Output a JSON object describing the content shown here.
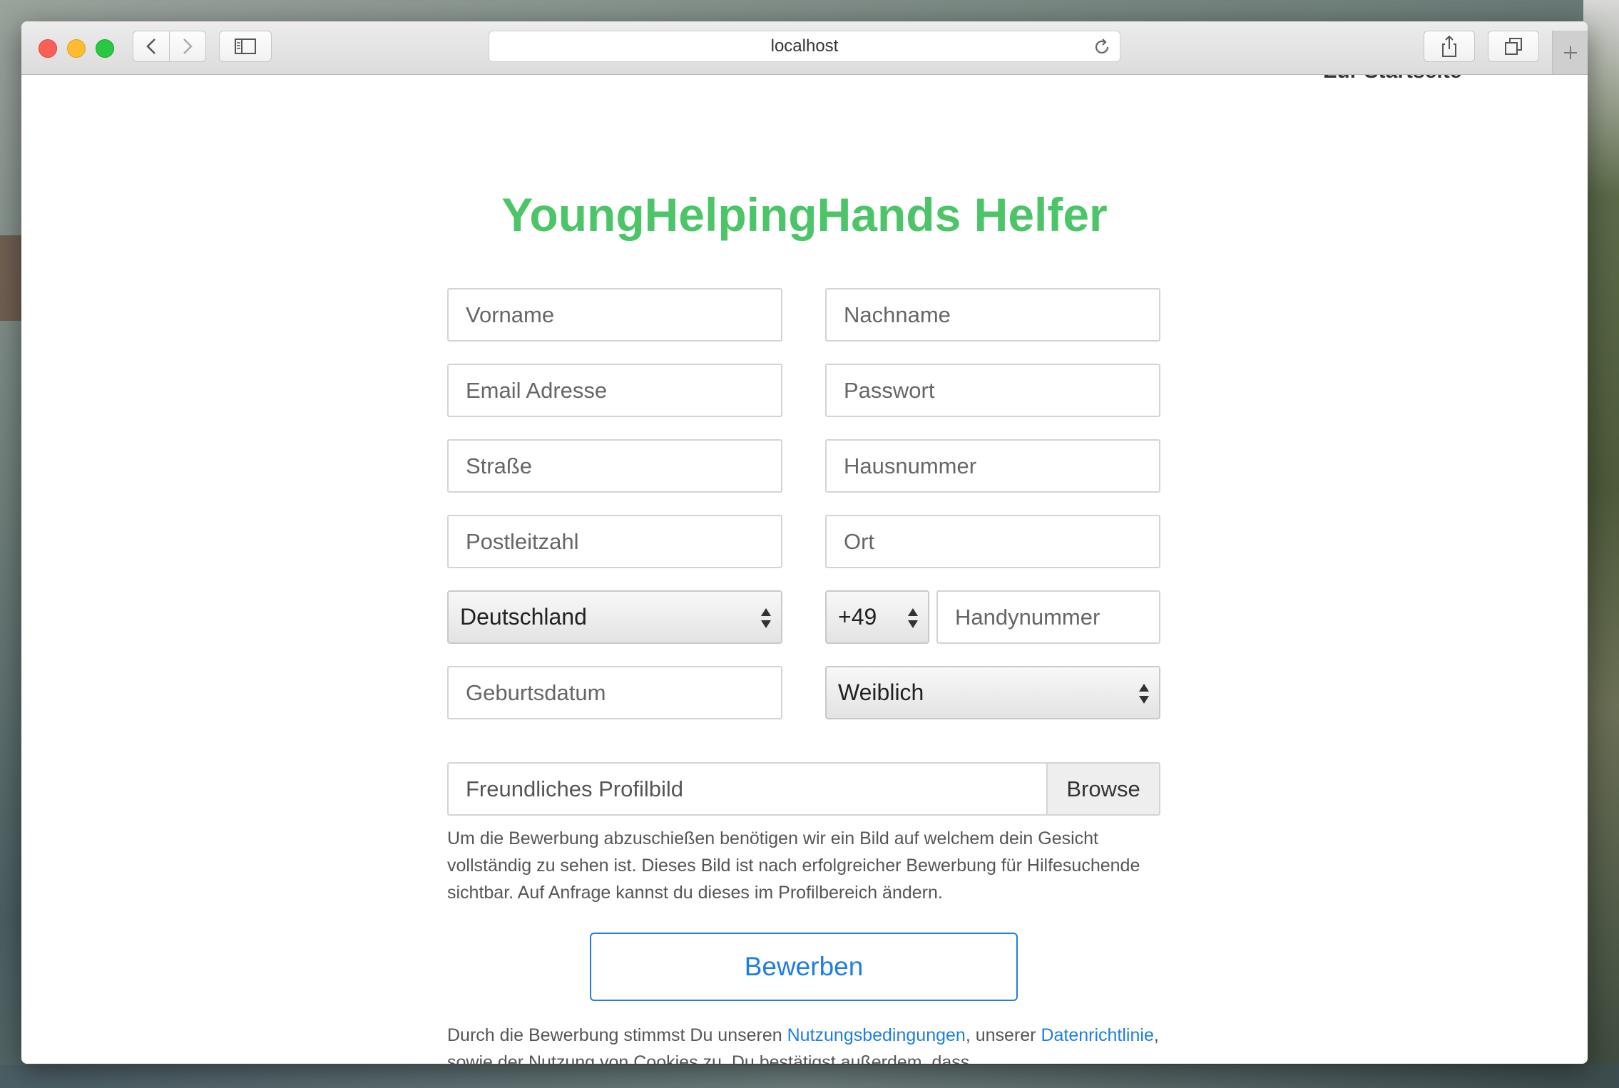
{
  "browser": {
    "address": "localhost"
  },
  "page": {
    "start_link": "Zur Startseite",
    "title": "YoungHelpingHands Helfer"
  },
  "form": {
    "vorname_placeholder": "Vorname",
    "nachname_placeholder": "Nachname",
    "email_placeholder": "Email Adresse",
    "passwort_placeholder": "Passwort",
    "strasse_placeholder": "Straße",
    "hausnummer_placeholder": "Hausnummer",
    "plz_placeholder": "Postleitzahl",
    "ort_placeholder": "Ort",
    "country_selected": "Deutschland",
    "phone_prefix_selected": "+49",
    "handy_placeholder": "Handynummer",
    "geburtsdatum_placeholder": "Geburtsdatum",
    "gender_selected": "Weiblich",
    "profilbild_label": "Freundliches Profilbild",
    "browse_label": "Browse",
    "profilbild_help": "Um die Bewerbung abzuschießen benötigen wir ein Bild auf welchem dein Gesicht vollständig zu sehen ist. Dieses Bild ist nach erfolgreicher Bewerbung für Hilfesuchende sichtbar. Auf Anfrage kannst du dieses im Profilbereich ändern.",
    "submit_label": "Bewerben"
  },
  "terms": {
    "part1": "Durch die Bewerbung stimmst Du unseren ",
    "link1": "Nutzungsbedingungen",
    "part2": ", unserer ",
    "link2": "Datenrichtlinie",
    "part3": ", sowie der Nutzung von Cookies zu. Du bestätigst außerdem, dass"
  },
  "colors": {
    "title_green": "#4bc568",
    "link_blue": "#1f7de4"
  },
  "icons": [
    "back-icon",
    "forward-icon",
    "sidebar-icon",
    "reload-icon",
    "share-icon",
    "tabs-icon",
    "plus-icon",
    "select-arrows-icon"
  ]
}
